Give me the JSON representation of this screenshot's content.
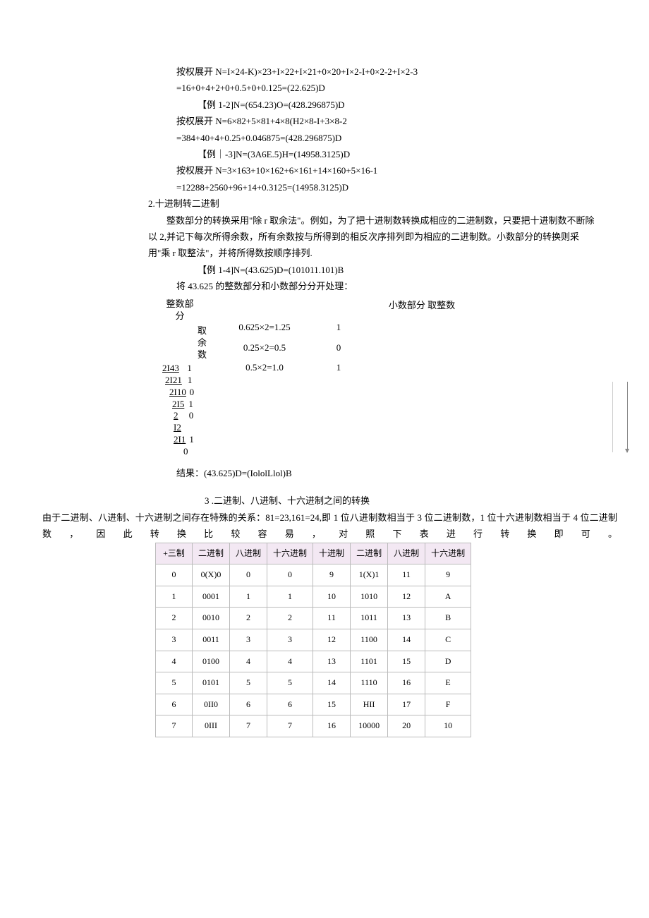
{
  "lines": {
    "l1": "按权展开 N=I×24-K)×23+I×22+I×21+0×20+I×2-I+0×2-2+I×2-3",
    "l2": "=16+0+4+2+0+0.5+0+0.125=(22.625)D",
    "l3": "【例 1-2]N=(654.23)O=(428.296875)D",
    "l4": "按权展开 N=6×82+5×81+4×8(H2×8-I+3×8-2",
    "l5": "=384+40+4+0.25+0.046875=(428.296875)D",
    "l6": "【例｜-3]N=(3A6E.5)H=(14958.3125)D",
    "l7": "按权展开 N=3×163+10×162+6×161+14×160+5×16-1",
    "l8": "=12288+2560+96+14+0.3125=(14958.3125)D",
    "l9": "2.十进制转二进制",
    "l10": "　　整数部分的转换采用\"除 r 取余法\"。例如，为了把十进制数转换成相应的二进制数，只要把十进制数不断除以 2,并记下每次所得余数，所有余数按与所得到的相反次序排列即为相应的二进制数。小数部分的转换则采用\"乘 r 取整法\"，并将所得数按顺序排列.",
    "l11": "【例 1-4]N=(43.625)D=(101011.101)B",
    "l12": "将 43.625 的整数部分和小数部分分开处理：",
    "intHead": "整数部分",
    "intSub": "取余数",
    "fracHead": "小数部分 取整数",
    "intRows": [
      {
        "l": "2I43",
        "r": "1"
      },
      {
        "l": "2I21",
        "r": "1"
      },
      {
        "l": "2I10",
        "r": "0"
      },
      {
        "l": "2I5",
        "r": "1"
      },
      {
        "l": "2  I2",
        "r": "0"
      },
      {
        "l": "2I1",
        "r": "1"
      },
      {
        "l": "0",
        "r": ""
      }
    ],
    "fracRows": [
      {
        "eq": "0.625×2=1.25",
        "dg": "1"
      },
      {
        "eq": "0.25×2=0.5",
        "dg": "0"
      },
      {
        "eq": "0.5×2=1.0",
        "dg": "1"
      }
    ],
    "result": "结果：(43.625)D=(IololLlol)B",
    "sec3": "3 .二进制、八进制、十六进制之间的转换",
    "para3": "由于二进制、八进制、十六进制之间存在特殊的关系：81=23,161=24,即 1 位八进制数相当于 3 位二进制数，1 位十六进制数相当于 4 位二进制数，因此转换比较容易，对照下表进行转换即可。"
  },
  "table": {
    "headers": [
      "+三制",
      "二进制",
      "八进制",
      "十六进制",
      "十进制",
      "二进制",
      "八进制",
      "十六进制"
    ],
    "rows": [
      [
        "0",
        "0(X)0",
        "0",
        "0",
        "9",
        "1(X)1",
        "11",
        "9"
      ],
      [
        "1",
        "0001",
        "1",
        "1",
        "10",
        "1010",
        "12",
        "A"
      ],
      [
        "2",
        "0010",
        "2",
        "2",
        "11",
        "1011",
        "13",
        "B"
      ],
      [
        "3",
        "0011",
        "3",
        "3",
        "12",
        "1100",
        "14",
        "C"
      ],
      [
        "4",
        "0100",
        "4",
        "4",
        "13",
        "1101",
        "15",
        "D"
      ],
      [
        "5",
        "0101",
        "5",
        "5",
        "14",
        "1110",
        "16",
        "E"
      ],
      [
        "6",
        "0II0",
        "6",
        "6",
        "15",
        "HII",
        "17",
        "F"
      ],
      [
        "7",
        "0III",
        "7",
        "7",
        "16",
        "10000",
        "20",
        "10"
      ]
    ]
  }
}
